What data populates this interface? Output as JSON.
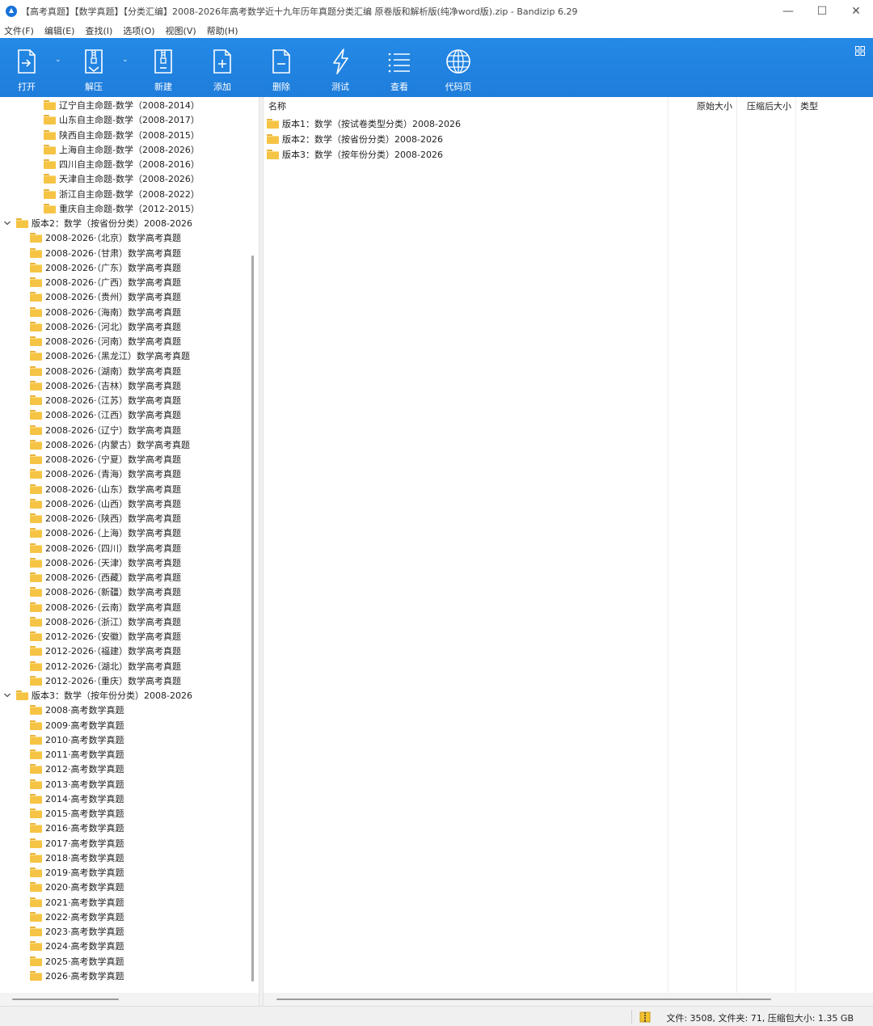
{
  "window": {
    "title": "【高考真题】【数学真题】【分类汇编】2008-2026年高考数学近十九年历年真题分类汇编  原卷版和解析版(纯净word版).zip - Bandizip 6.29",
    "minimize_glyph": "—",
    "maximize_glyph": "☐",
    "close_glyph": "✕"
  },
  "menu": [
    "文件(F)",
    "编辑(E)",
    "查找(I)",
    "选项(O)",
    "视图(V)",
    "帮助(H)"
  ],
  "toolbar": {
    "open": "打开",
    "extract": "解压",
    "new": "新建",
    "add": "添加",
    "delete": "删除",
    "test": "测试",
    "view": "查看",
    "codepage": "代码页",
    "dropdown_glyph": "⌄",
    "accent": "#1f7ddb"
  },
  "tree": {
    "v1_children": [
      "辽宁自主命题-数学（2008-2014）",
      "山东自主命题-数学（2008-2017）",
      "陕西自主命题-数学（2008-2015）",
      "上海自主命题-数学（2008-2026）",
      "四川自主命题-数学（2008-2016）",
      "天津自主命题-数学（2008-2026）",
      "浙江自主命题-数学（2008-2022）",
      "重庆自主命题-数学（2012-2015）"
    ],
    "v2_label": "版本2：数学（按省份分类）2008-2026",
    "v2_children": [
      "2008-2026·（北京）数学高考真题",
      "2008-2026·（甘肃）数学高考真题",
      "2008-2026·（广东）数学高考真题",
      "2008-2026·（广西）数学高考真题",
      "2008-2026·（贵州）数学高考真题",
      "2008-2026·（海南）数学高考真题",
      "2008-2026·（河北）数学高考真题",
      "2008-2026·（河南）数学高考真题",
      "2008-2026·（黑龙江）数学高考真题",
      "2008-2026·（湖南）数学高考真题",
      "2008-2026·（吉林）数学高考真题",
      "2008-2026·（江苏）数学高考真题",
      "2008-2026·（江西）数学高考真题",
      "2008-2026·（辽宁）数学高考真题",
      "2008-2026·（内蒙古）数学高考真题",
      "2008-2026·（宁夏）数学高考真题",
      "2008-2026·（青海）数学高考真题",
      "2008-2026·（山东）数学高考真题",
      "2008-2026·（山西）数学高考真题",
      "2008-2026·（陕西）数学高考真题",
      "2008-2026·（上海）数学高考真题",
      "2008-2026·（四川）数学高考真题",
      "2008-2026·（天津）数学高考真题",
      "2008-2026·（西藏）数学高考真题",
      "2008-2026·（新疆）数学高考真题",
      "2008-2026·（云南）数学高考真题",
      "2008-2026·（浙江）数学高考真题",
      "2012-2026·（安徽）数学高考真题",
      "2012-2026·（福建）数学高考真题",
      "2012-2026·（湖北）数学高考真题",
      "2012-2026·（重庆）数学高考真题"
    ],
    "v3_label": "版本3：数学（按年份分类）2008-2026",
    "v3_children": [
      "2008·高考数学真题",
      "2009·高考数学真题",
      "2010·高考数学真题",
      "2011·高考数学真题",
      "2012·高考数学真题",
      "2013·高考数学真题",
      "2014·高考数学真题",
      "2015·高考数学真题",
      "2016·高考数学真题",
      "2017·高考数学真题",
      "2018·高考数学真题",
      "2019·高考数学真题",
      "2020·高考数学真题",
      "2021·高考数学真题",
      "2022·高考数学真题",
      "2023·高考数学真题",
      "2024·高考数学真题",
      "2025·高考数学真题",
      "2026·高考数学真题"
    ]
  },
  "list": {
    "columns": {
      "name": "名称",
      "original_size": "原始大小",
      "compressed_size": "压缩后大小",
      "type": "类型"
    },
    "sort_glyph": "^",
    "rows": [
      "版本1：数学（按试卷类型分类）2008-2026",
      "版本2：数学（按省份分类）2008-2026",
      "版本3：数学（按年份分类）2008-2026"
    ]
  },
  "status": {
    "summary": "文件: 3508, 文件夹: 71, 压缩包大小: 1.35 GB"
  },
  "colors": {
    "folder": "#f6c444",
    "toolbar_blue": "#1f7ddb"
  }
}
